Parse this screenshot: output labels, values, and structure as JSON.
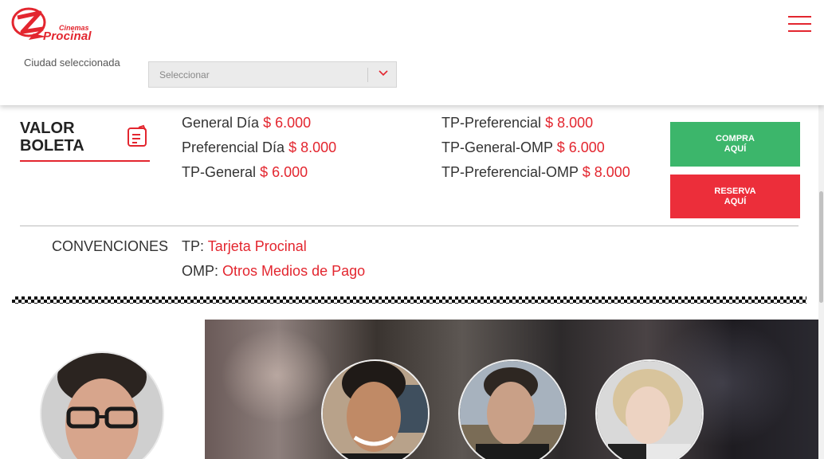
{
  "header": {
    "logo_small": "Cinemas",
    "logo_big": "Procinal",
    "city_label": "Ciudad seleccionada",
    "city_select_value": "Seleccionar"
  },
  "valor_boleta": {
    "title_line1": "VALOR",
    "title_line2": "BOLETA",
    "prices_left": [
      {
        "label": "General Día",
        "amount": "$ 6.000"
      },
      {
        "label": "Preferencial Día",
        "amount": "$ 8.000"
      },
      {
        "label": "TP-General",
        "amount": "$ 6.000"
      }
    ],
    "prices_right": [
      {
        "label": "TP-Preferencial",
        "amount": "$ 8.000"
      },
      {
        "label": "TP-General-OMP",
        "amount": "$ 6.000"
      },
      {
        "label": "TP-Preferencial-OMP",
        "amount": "$ 8.000"
      }
    ]
  },
  "buttons": {
    "compra_line1": "COMPRA",
    "compra_line2": "AQUÍ",
    "reserva_line1": "RESERVA",
    "reserva_line2": "AQUÍ"
  },
  "conventions": {
    "label": "CONVENCIONES",
    "items": [
      {
        "abbr": "TP:",
        "meaning": "Tarjeta Procinal"
      },
      {
        "abbr": "OMP:",
        "meaning": "Otros Medios de Pago"
      }
    ]
  },
  "colors": {
    "brand_red": "#e3262f",
    "compra_green": "#3cb66b",
    "reserva_red": "#ec2e3a"
  },
  "icons": [
    "menu-icon",
    "chevron-down-icon",
    "ticket-icon"
  ]
}
